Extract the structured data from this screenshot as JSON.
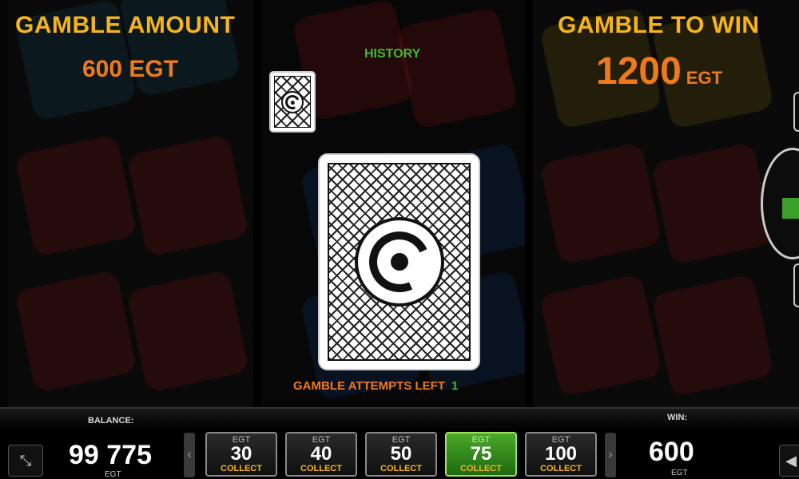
{
  "left_panel": {
    "title": "GAMBLE AMOUNT",
    "amount": "600 EGT"
  },
  "right_panel": {
    "title": "GAMBLE TO WIN",
    "amount_value": "1200",
    "amount_currency": "EGT"
  },
  "history": {
    "label": "HISTORY"
  },
  "attempts": {
    "label": "GAMBLE ATTEMPTS LEFT",
    "count": "1"
  },
  "bottom_bar": {
    "balance_label": "BALANCE:",
    "balance_value": "99 775",
    "balance_currency": "EGT",
    "win_label": "WIN:",
    "win_value": "600",
    "win_currency": "EGT",
    "coins": [
      {
        "currency": "EGT",
        "value": "30",
        "action": "COLLECT",
        "active": false
      },
      {
        "currency": "EGT",
        "value": "40",
        "action": "COLLECT",
        "active": false
      },
      {
        "currency": "EGT",
        "value": "50",
        "action": "COLLECT",
        "active": false
      },
      {
        "currency": "EGT",
        "value": "75",
        "action": "COLLECT",
        "active": true
      },
      {
        "currency": "EGT",
        "value": "100",
        "action": "COLLECT",
        "active": false
      }
    ],
    "arrow_left": "‹",
    "arrow_right": "›",
    "fullscreen_icon": "⤡",
    "sound_icon": "◀"
  },
  "colors": {
    "title": "#f7b41b",
    "amount": "#f07a1a",
    "history": "#44b82a",
    "active_coin": "#4aa82a"
  }
}
